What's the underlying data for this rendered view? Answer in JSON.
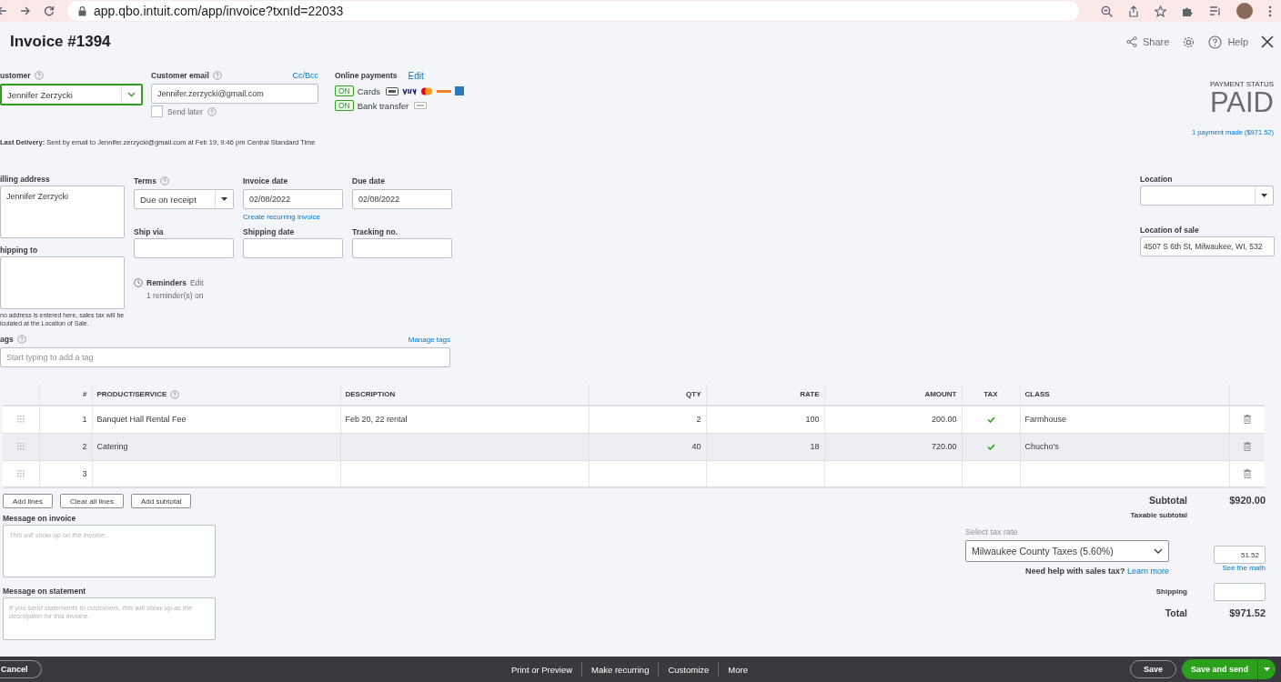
{
  "browser": {
    "url": "app.qbo.intuit.com/app/invoice?txnId=22033"
  },
  "header": {
    "title": "Invoice #1394",
    "actions": [
      {
        "kind": "share",
        "label": "Share"
      },
      {
        "kind": "settings"
      },
      {
        "kind": "help",
        "label": "Help"
      },
      {
        "kind": "close"
      }
    ]
  },
  "customer": {
    "label": "ustomer",
    "value": "Jennifer Zerzycki"
  },
  "customer_email": {
    "label": "Customer email",
    "value": "Jennifer.zerzycki@gmail.com",
    "link": "Cc/Bcc",
    "send_later": {
      "label": "Send later",
      "checked": false
    }
  },
  "online_payments": {
    "label": "Online payments",
    "edit": "Edit",
    "methods": [
      {
        "kind": "cards",
        "badge": "ON",
        "label": "Cards",
        "on": true
      },
      {
        "kind": "bank",
        "badge": "ON",
        "label": "Bank transfer",
        "on": true
      }
    ]
  },
  "last_delivery": {
    "label": "Last Delivery:",
    "text": "Sent by email to Jennifer.zerzycki@gmail.com at Feb 19, 9:46 pm Central Standard Time"
  },
  "payment_status": {
    "label": "PAYMENT STATUS",
    "value": "PAID",
    "link": "1 payment made ($971.52)"
  },
  "billing_address": {
    "label": "illing address",
    "value": "Jennifer Zerzycki"
  },
  "shipping_to": {
    "label": "hipping to",
    "note": [
      "no address is entered here, sales tax will be",
      "lculated at the Location of Sale."
    ]
  },
  "terms": {
    "label": "Terms",
    "value": "Due on receipt"
  },
  "invoice_date": {
    "label": "Invoice date",
    "value": "02/08/2022",
    "link": "Create recurring invoice"
  },
  "due_date": {
    "label": "Due date",
    "value": "02/08/2022"
  },
  "ship_via": {
    "label": "Ship via"
  },
  "shipping_date": {
    "label": "Shipping date"
  },
  "tracking_no": {
    "label": "Tracking no."
  },
  "reminders": {
    "label": "Reminders",
    "edit": "Edit",
    "status": "1 reminder(s) on"
  },
  "tags": {
    "label": "ags",
    "link": "Manage tags",
    "placeholder": "Start typing to add a tag"
  },
  "location": {
    "label": "Location"
  },
  "location_of_sale": {
    "label": "Location of sale",
    "value": "4507 S 6th St, Milwaukee, WI, 532"
  },
  "table": {
    "columns": [
      "#",
      "PRODUCT/SERVICE",
      "DESCRIPTION",
      "QTY",
      "RATE",
      "AMOUNT",
      "TAX",
      "CLASS"
    ],
    "rows": [
      {
        "num": "1",
        "product": "Banquet Hall Rental Fee",
        "description": "Feb 20, 22 rental",
        "qty": "2",
        "rate": "100",
        "amount": "200.00",
        "taxable": true,
        "class": "Farmhouse",
        "selected": false
      },
      {
        "num": "2",
        "product": "Catering",
        "description": "",
        "qty": "40",
        "rate": "18",
        "amount": "720.00",
        "taxable": true,
        "class": "Chucho's",
        "selected": true
      },
      {
        "num": "3",
        "product": "",
        "description": "",
        "qty": "",
        "rate": "",
        "amount": "",
        "taxable": false,
        "class": "",
        "selected": false
      }
    ]
  },
  "table_buttons": [
    "Add lines",
    "Clear all lines",
    "Add subtotal"
  ],
  "message_invoice": {
    "label": "Message on invoice",
    "placeholder": "This will show up on the invoice."
  },
  "message_statement": {
    "label": "Message on statement",
    "placeholder": "If you send statements to customers, this will show up as the description for this invoice."
  },
  "totals": {
    "subtotal": {
      "label": "Subtotal",
      "value": "$920.00"
    },
    "taxable_subtotal": {
      "label": "Taxable subtotal"
    },
    "tax_rate": {
      "label": "Select tax rate",
      "value": "Milwaukee County Taxes (5.60%)",
      "amount": "51.52",
      "math_link": "See the math"
    },
    "tax_help": {
      "text": "Need help with sales tax?",
      "link": "Learn more"
    },
    "shipping": {
      "label": "Shipping"
    },
    "total": {
      "label": "Total",
      "value": "$971.52"
    }
  },
  "footer": {
    "cancel": "Cancel",
    "actions": [
      "Print or Preview",
      "Make recurring",
      "Customize",
      "More"
    ],
    "save": "Save",
    "save_send": "Save and send"
  }
}
